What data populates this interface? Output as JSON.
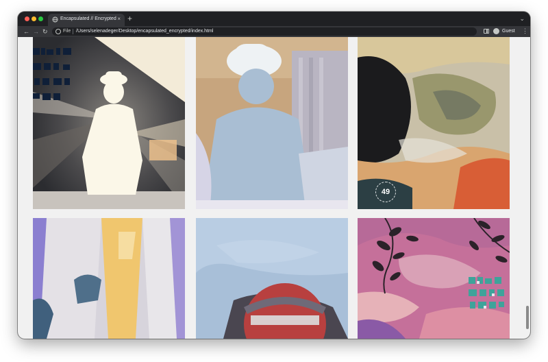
{
  "browser": {
    "tab": {
      "title": "Encapsulated // Encrypted",
      "favicon": "globe-icon",
      "close_glyph": "×"
    },
    "new_tab_glyph": "+",
    "tab_menu_glyph": "⌄",
    "nav": {
      "back": "←",
      "forward": "→",
      "reload": "↻"
    },
    "address": {
      "scheme": "File",
      "url": "/Users/selenadeger/Desktop/encapsulated_encrypted/index.html"
    },
    "profile": {
      "label": "Guest"
    },
    "menu_glyph": "⋮"
  },
  "gallery": {
    "tiles": [
      {
        "name": "figure-with-hat-light-rays",
        "logo": "encrypted-logo-dark"
      },
      {
        "name": "figure-with-hat-pale-blue"
      },
      {
        "name": "abstract-wave-dark",
        "badge": "49"
      },
      {
        "name": "figure-white-coat-purple"
      },
      {
        "name": "red-sign-blue-sky"
      },
      {
        "name": "leaves-pink-sky",
        "logo": "encrypted-logo-teal"
      }
    ]
  },
  "colors": {
    "chrome_dark": "#1f2023",
    "chrome_tab": "#35363a",
    "page_bg": "#f1f1f1"
  }
}
